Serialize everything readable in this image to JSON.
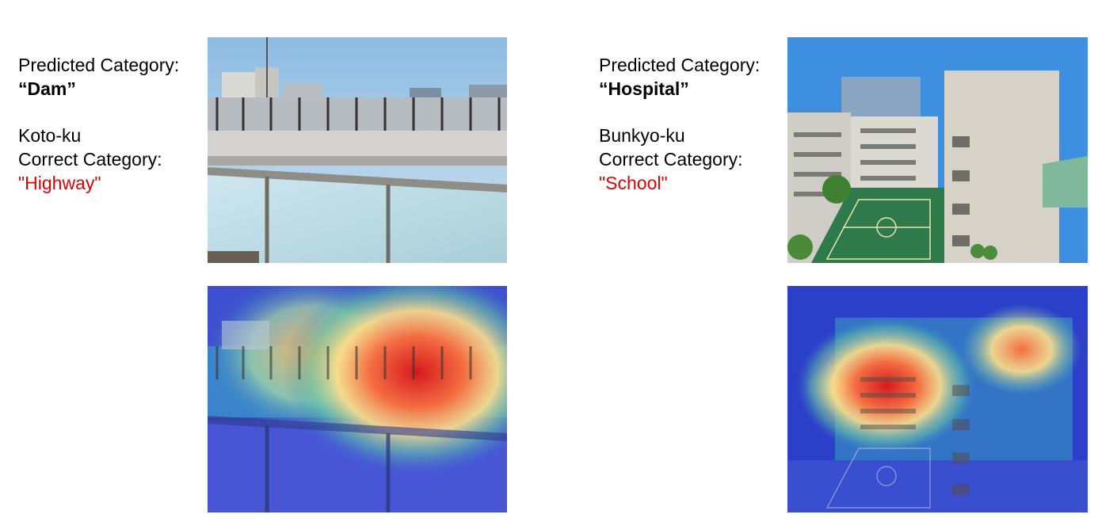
{
  "left": {
    "predicted_label": "Predicted Category:",
    "predicted_value": "“Dam”",
    "location": "Koto-ku",
    "correct_label": "Correct Category:",
    "correct_value": "\"Highway\""
  },
  "right": {
    "predicted_label": "Predicted Category:",
    "predicted_value": "“Hospital”",
    "location": "Bunkyo-ku",
    "correct_label": "Correct Category:",
    "correct_value": "\"School\""
  },
  "colors": {
    "correct_text": "#e00000",
    "sky": "#7fb3e0",
    "heat_hot": "#d7191c",
    "heat_cold": "#2b3cc4"
  }
}
